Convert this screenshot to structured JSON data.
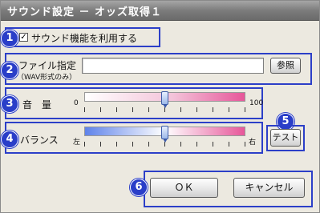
{
  "window": {
    "title": "サウンド設定 － オッズ取得１"
  },
  "badges": [
    "1",
    "2",
    "3",
    "4",
    "5",
    "6"
  ],
  "sound_enable": {
    "label": "サウンド機能を利用する",
    "checked": true,
    "check_mark": "✓"
  },
  "file": {
    "label": "ファイル指定",
    "hint": "（WAV形式のみ）",
    "value": "",
    "browse_label": "参照"
  },
  "volume": {
    "label": "音　量",
    "min_label": "0",
    "max_label": "100",
    "value": 50,
    "min": 0,
    "max": 100
  },
  "balance": {
    "label": "バランス",
    "left_label": "左",
    "right_label": "右",
    "value": 0.5
  },
  "test_button": {
    "label": "テスト"
  },
  "ok_button": {
    "label": "ＯＫ"
  },
  "cancel_button": {
    "label": "キャンセル"
  },
  "colors": {
    "frame": "#2c3fc8",
    "badge": "#2a3ec8",
    "volume_gradient_start": "#ffffff",
    "volume_gradient_end": "#e7579a",
    "balance_left": "#5f83ea",
    "balance_right": "#e7579a"
  }
}
